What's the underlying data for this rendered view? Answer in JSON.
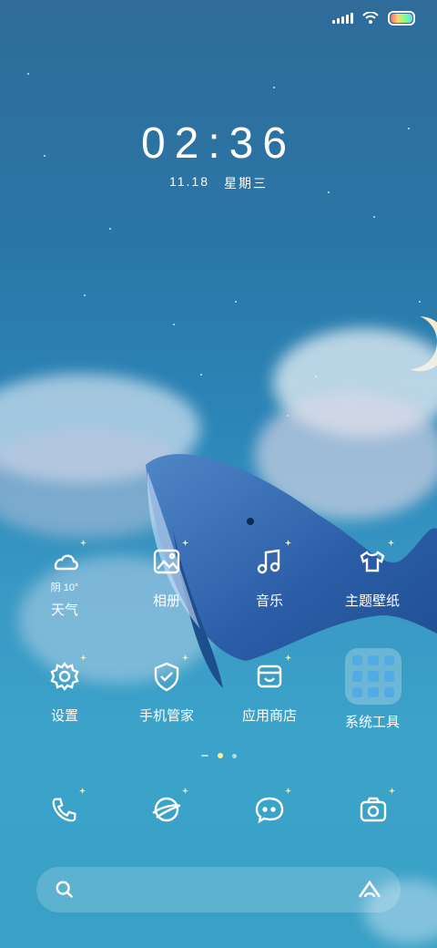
{
  "status_bar": {
    "signal_icon": "signal-icon",
    "wifi_icon": "wifi-icon",
    "battery_icon": "battery-icon"
  },
  "clock": {
    "time": "02:36",
    "date": "11.18",
    "weekday": "星期三"
  },
  "apps": [
    {
      "label": "天气",
      "icon": "weather-icon",
      "temp": "阴 10°"
    },
    {
      "label": "相册",
      "icon": "gallery-icon"
    },
    {
      "label": "音乐",
      "icon": "music-icon"
    },
    {
      "label": "主题壁纸",
      "icon": "theme-icon"
    },
    {
      "label": "设置",
      "icon": "settings-icon"
    },
    {
      "label": "手机管家",
      "icon": "security-icon"
    },
    {
      "label": "应用商店",
      "icon": "app-store-icon"
    },
    {
      "label": "系统工具",
      "icon": "folder-icon"
    }
  ],
  "page_indicator": {
    "pages": 3,
    "current": 2
  },
  "dock": [
    {
      "name": "phone",
      "icon": "phone-icon"
    },
    {
      "name": "browser",
      "icon": "browser-icon"
    },
    {
      "name": "messages",
      "icon": "messages-icon"
    },
    {
      "name": "camera",
      "icon": "camera-icon"
    }
  ],
  "search_bar": {
    "left_icon": "search-icon",
    "right_icon": "assistant-icon"
  }
}
